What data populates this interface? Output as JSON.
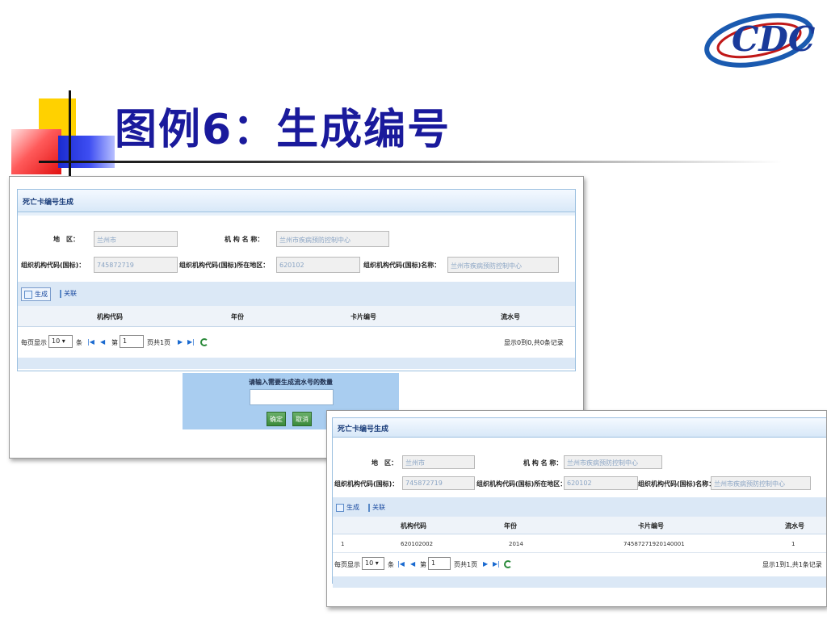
{
  "slide": {
    "title": "图例6：生成编号",
    "logo_text": "CDC",
    "colors": {
      "title": "#1a1a9c",
      "accent_blue": "#1a2bd0",
      "accent_red": "#e01010",
      "accent_yellow": "#ffd100"
    }
  },
  "form": {
    "panel_title": "死亡卡编号生成",
    "region_label": "地　区：",
    "region_value": "兰州市",
    "org_name_label": "机 构 名 称：",
    "org_name_value": "兰州市疾病预防控制中心",
    "org_code_label": "组织机构代码(国标)：",
    "org_code_value": "745872719",
    "org_area_label": "组织机构代码(国标)所在地区：",
    "org_area_value": "620102",
    "org_name2_label": "组织机构代码(国标)名称：",
    "org_name2_value": "兰州市疾病预防控制中心"
  },
  "toolbar": {
    "generate_label": "生成",
    "close_label": "关联"
  },
  "table": {
    "columns": [
      "机构代码",
      "年份",
      "卡片编号",
      "流水号"
    ]
  },
  "pager": {
    "per_page_label": "每页显示",
    "per_page_value": "10 ▾",
    "items_unit": "条",
    "page_prefix": "第",
    "page_value": "1",
    "page_suffix": "页共1页",
    "first_icon": "|◀",
    "prev_icon": "◀",
    "next_icon": "▶",
    "last_icon": "▶|"
  },
  "dialog": {
    "prompt": "请输入需要生成流水号的数量",
    "input_value": "",
    "ok_label": "确定",
    "cancel_label": "取消"
  },
  "screenshot1": {
    "status": "显示0到0,共0条记录"
  },
  "screenshot2": {
    "row": {
      "org_code": "620102002",
      "year": "2014",
      "card_no": "7458727192014000​1",
      "serial": "1"
    },
    "status": "显示1到1,共1条记录"
  }
}
